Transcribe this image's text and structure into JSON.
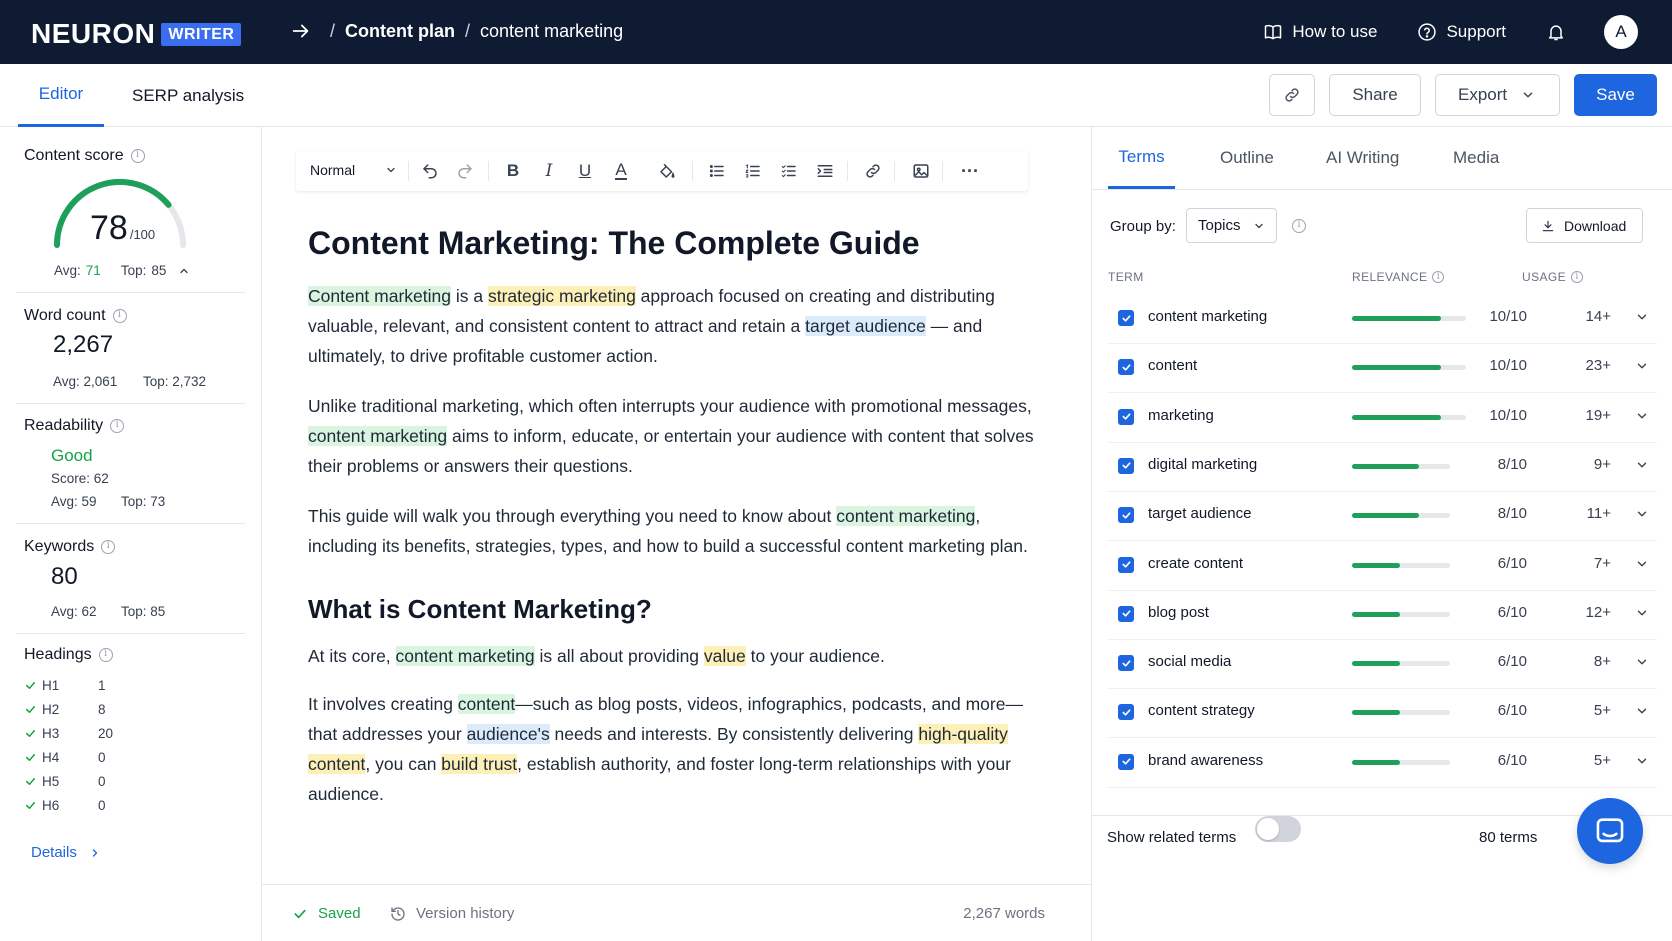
{
  "brand": {
    "name": "NEURON",
    "badge": "WRITER"
  },
  "breadcrumb": {
    "item1": "Content plan",
    "item2": "content marketing"
  },
  "nav": {
    "how_to_use": "How to use",
    "support": "Support",
    "avatar_letter": "A"
  },
  "tabs": {
    "editor": "Editor",
    "serp": "SERP analysis"
  },
  "actions": {
    "share": "Share",
    "export": "Export",
    "save": "Save"
  },
  "sidebar": {
    "content_score": {
      "label": "Content score",
      "value": "78",
      "max": "/100",
      "score_fraction": 0.78,
      "avg_label": "Avg:",
      "avg": "71",
      "top_label": "Top:",
      "top": "85"
    },
    "word_count": {
      "label": "Word count",
      "value": "2,267",
      "avg_text": "Avg: 2,061",
      "top_text": "Top: 2,732"
    },
    "readability": {
      "label": "Readability",
      "status": "Good",
      "score_text": "Score: 62",
      "avg_text": "Avg: 59",
      "top_text": "Top: 73"
    },
    "keywords": {
      "label": "Keywords",
      "value": "80",
      "avg_text": "Avg: 62",
      "top_text": "Top: 85"
    },
    "headings": {
      "label": "Headings",
      "items": [
        {
          "tag": "H1",
          "count": "1"
        },
        {
          "tag": "H2",
          "count": "8"
        },
        {
          "tag": "H3",
          "count": "20"
        },
        {
          "tag": "H4",
          "count": "0"
        },
        {
          "tag": "H5",
          "count": "0"
        },
        {
          "tag": "H6",
          "count": "0"
        }
      ]
    },
    "details": "Details"
  },
  "toolbar": {
    "style": "Normal"
  },
  "document": {
    "title": "Content Marketing: The Complete Guide",
    "p1": {
      "a": "Content marketing",
      "b": " is a ",
      "c": "strategic marketing",
      "d": " approach focused on creating and distributing valuable, relevant, and consistent content to attract and retain a ",
      "e": "target audience",
      "f": " — and ultimately, to drive profitable customer action."
    },
    "p2": {
      "a": "Unlike traditional marketing, which often interrupts your audience with promotional messages, ",
      "b": "content marketing",
      "c": " aims to inform, educate, or entertain your audience with content that solves their problems or answers their questions."
    },
    "p3": {
      "a": "This guide will walk you through everything you need to know about ",
      "b": "content marketing",
      "c": ", including its benefits, strategies, types, and how to build a successful content marketing plan."
    },
    "h2": "What is Content Marketing?",
    "p4": {
      "a": "At its core, ",
      "b": "content marketing",
      "c": " is all about providing ",
      "d": "value",
      "e": " to your audience."
    },
    "p5": {
      "a": "It involves creating ",
      "b": "content",
      "c": "—such as blog posts, videos, infographics, podcasts, and more—that addresses your ",
      "d": "audience's",
      "e": " needs and interests. By consistently delivering ",
      "f": "high-quality content",
      "g": ", you can ",
      "h": "build trust",
      "i": ", establish authority, and foster long-term relationships with your audience."
    }
  },
  "footer": {
    "saved": "Saved",
    "version_history": "Version history",
    "word_count": "2,267 words"
  },
  "panel": {
    "tabs": {
      "terms": "Terms",
      "outline": "Outline",
      "ai_writing": "AI Writing",
      "media": "Media"
    },
    "group_by_label": "Group by:",
    "group_by_value": "Topics",
    "download": "Download",
    "columns": {
      "term": "TERM",
      "relevance": "RELEVANCE",
      "usage": "USAGE"
    },
    "terms": [
      {
        "term": "content marketing",
        "relevance": 0.78,
        "usage": "10/10",
        "count": "14+"
      },
      {
        "term": "content",
        "relevance": 0.78,
        "usage": "10/10",
        "count": "23+"
      },
      {
        "term": "marketing",
        "relevance": 0.78,
        "usage": "10/10",
        "count": "19+"
      },
      {
        "term": "digital marketing",
        "relevance": 0.68,
        "usage": "8/10",
        "count": "9+"
      },
      {
        "term": "target audience",
        "relevance": 0.68,
        "usage": "8/10",
        "count": "11+"
      },
      {
        "term": "create content",
        "relevance": 0.49,
        "usage": "6/10",
        "count": "7+"
      },
      {
        "term": "blog post",
        "relevance": 0.49,
        "usage": "6/10",
        "count": "12+"
      },
      {
        "term": "social media",
        "relevance": 0.49,
        "usage": "6/10",
        "count": "8+"
      },
      {
        "term": "content strategy",
        "relevance": 0.49,
        "usage": "6/10",
        "count": "5+"
      },
      {
        "term": "brand awareness",
        "relevance": 0.49,
        "usage": "6/10",
        "count": "5+"
      }
    ],
    "show_related": "Show related terms",
    "show_related_on": false,
    "terms_count": "80 terms"
  },
  "colors": {
    "primary": "#1d66e0",
    "navbar": "#0f1b33",
    "good": "#1fa05a"
  }
}
